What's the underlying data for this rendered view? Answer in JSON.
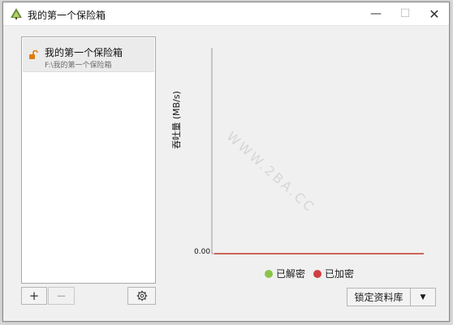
{
  "window": {
    "title": "我的第一个保险箱",
    "minimize_glyph": "—",
    "maximize_glyph": "☐",
    "close_glyph": "✕"
  },
  "vault_list": {
    "items": [
      {
        "name": "我的第一个保险箱",
        "path": "F:\\我的第一个保险箱",
        "icon": "unlocked-padlock-icon",
        "icon_color": "#e07b00"
      }
    ]
  },
  "list_controls": {
    "add_label": "+",
    "remove_label": "−",
    "settings_icon": "gear-icon"
  },
  "chart_data": {
    "type": "line",
    "ylabel": "吞吐量 (MB/s)",
    "y_ticks": [
      "0.00"
    ],
    "series": [
      {
        "name": "已解密",
        "color": "#8bc34a",
        "values": [
          0,
          0
        ]
      },
      {
        "name": "已加密",
        "color": "#d04040",
        "values": [
          0,
          0
        ]
      }
    ]
  },
  "watermark": "WWW.2BA.CC",
  "actions": {
    "lock_vault_label": "锁定资料库",
    "dropdown_glyph": "▼"
  }
}
